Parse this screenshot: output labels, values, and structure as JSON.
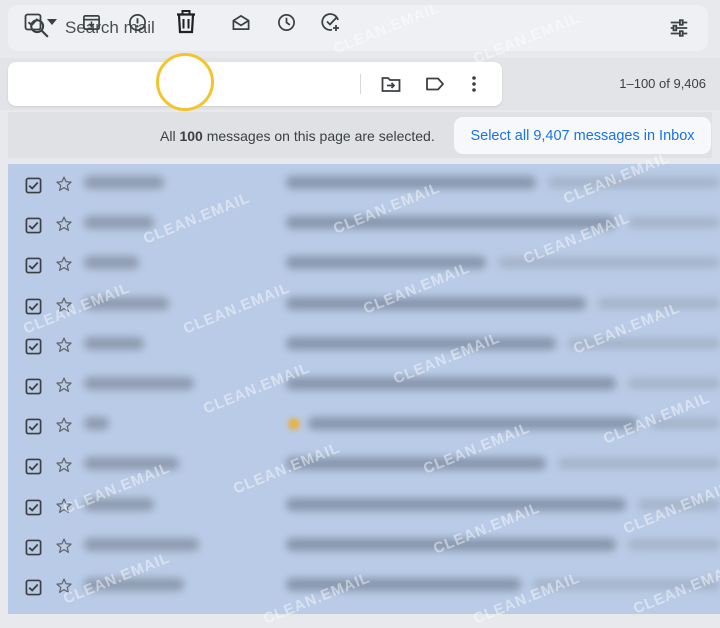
{
  "search": {
    "placeholder": "Search mail"
  },
  "toolbar": {
    "icons": [
      "select-all-checkbox-icon",
      "select-dropdown-icon",
      "archive-icon",
      "report-spam-icon",
      "delete-icon",
      "mark-as-read-icon",
      "snooze-icon",
      "add-to-tasks-icon",
      "move-to-icon",
      "label-icon",
      "more-icon"
    ],
    "count": "1–100 of 9,406"
  },
  "banner": {
    "text_prefix": "All ",
    "selected_count": "100",
    "text_suffix": " messages on this page are selected.",
    "select_all_label": "Select all 9,407 messages in Inbox"
  },
  "watermark": "CLEAN.EMAIL",
  "colors": {
    "accent": "#1a73e8",
    "highlight_ring": "#f4c430",
    "selected_row": "#b9cbe6"
  }
}
